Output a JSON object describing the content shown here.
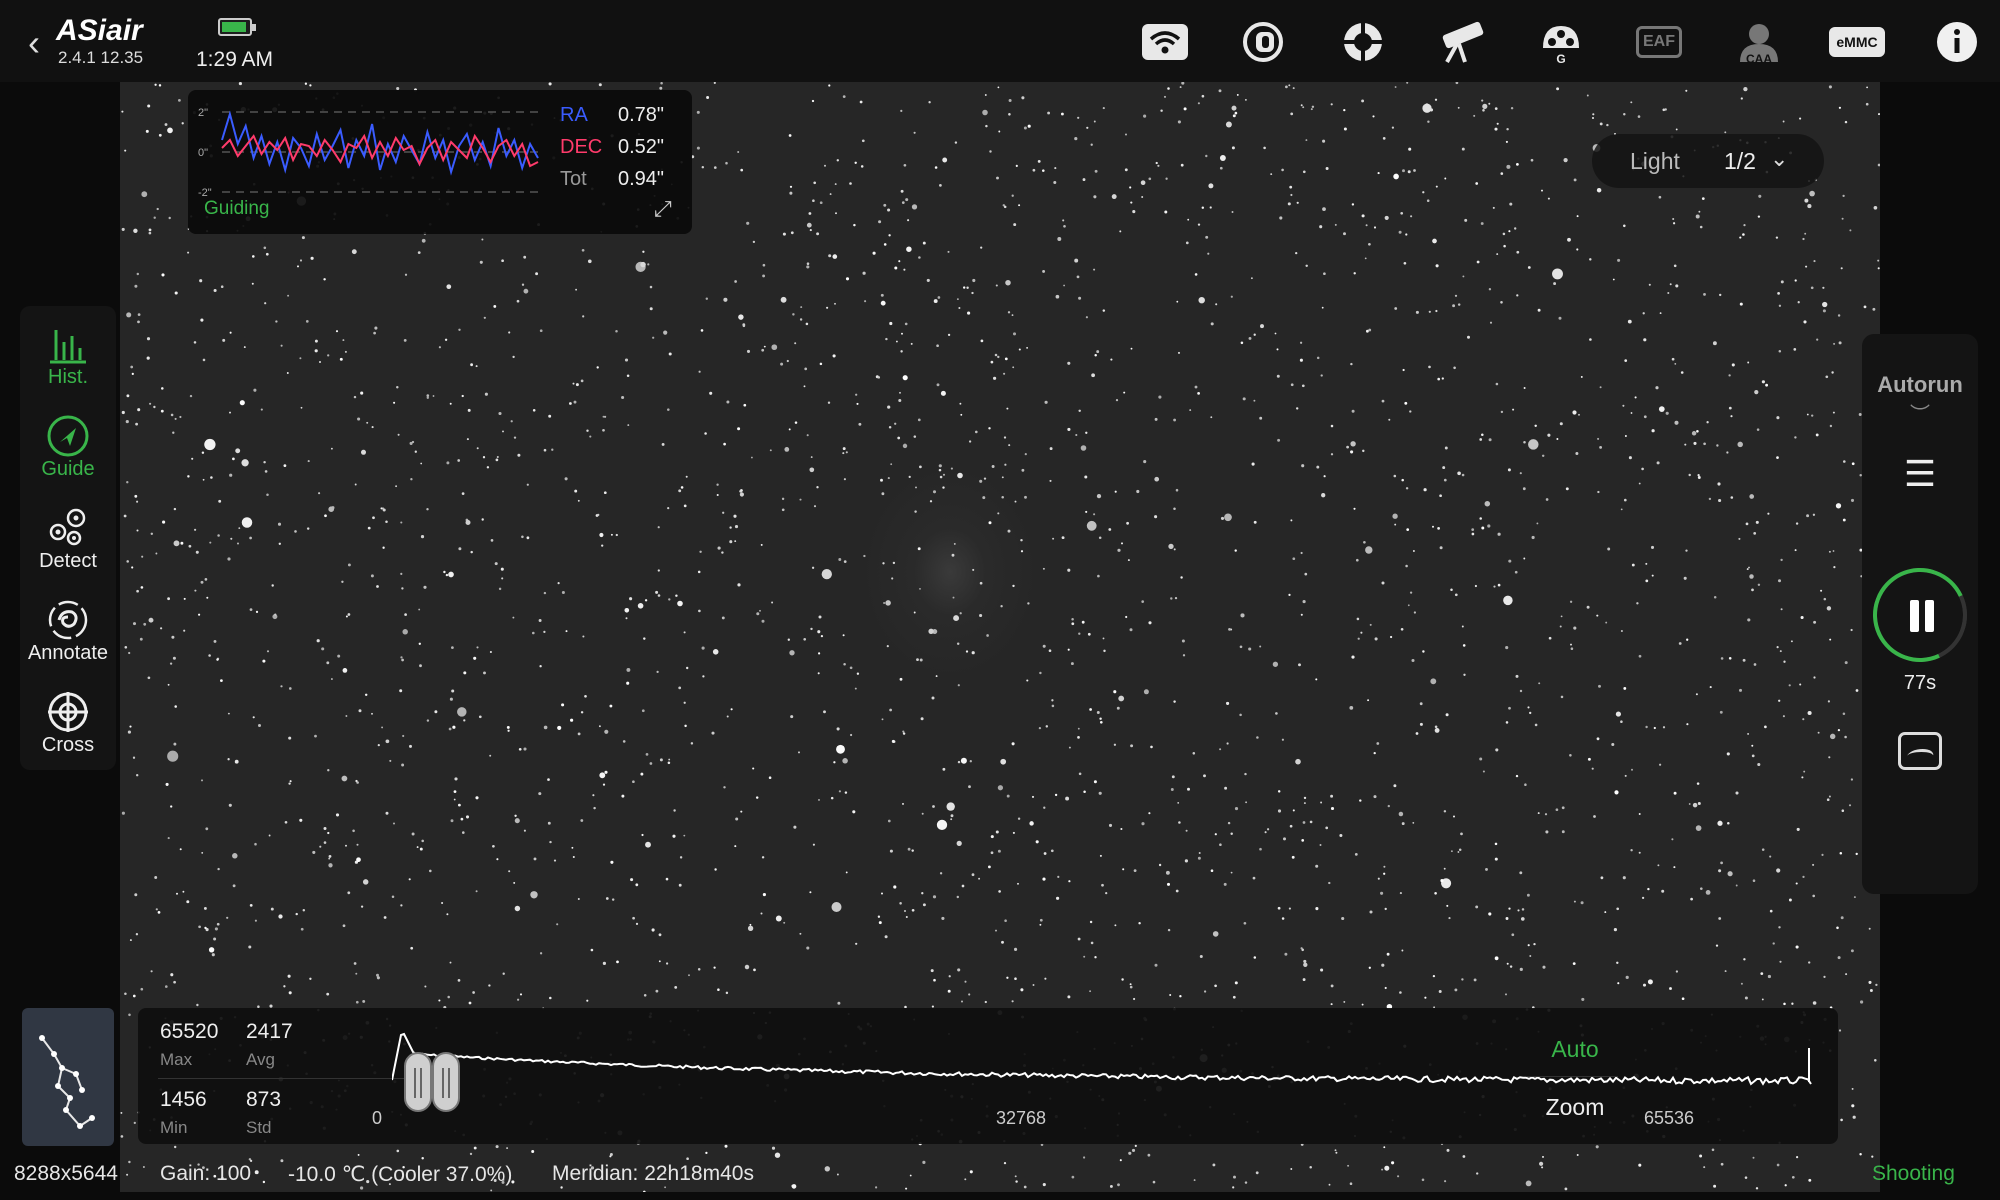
{
  "app": {
    "brand": "ASiair",
    "version": "2.4.1 12.35",
    "time": "1:29 AM",
    "back_icon": "chevron-left-icon"
  },
  "toolbar": {
    "icons": [
      "wifi-icon",
      "camera-icon",
      "focus-target-icon",
      "telescope-icon",
      "guide-camera-icon",
      "eaf-icon",
      "caa-icon",
      "emmc-icon",
      "info-icon"
    ],
    "guide_cam_label": "G",
    "eaf_label": "EAF",
    "caa_label": "CAA",
    "emmc_label": "eMMC"
  },
  "guide": {
    "axis_top": "2\"",
    "axis_mid": "0\"",
    "axis_bot": "-2\"",
    "ra_label": "RA",
    "ra_value": "0.78\"",
    "dec_label": "DEC",
    "dec_value": "0.52\"",
    "tot_label": "Tot",
    "tot_value": "0.94\"",
    "status": "Guiding",
    "colors": {
      "ra": "#3a5cff",
      "dec": "#ff3b6b",
      "status": "#39b54a"
    },
    "ra_trace": [
      0.6,
      1.9,
      0.4,
      1.3,
      -0.3,
      0.8,
      -0.6,
      0.5,
      -0.9,
      0.7,
      0.2,
      -0.7,
      0.9,
      -0.4,
      0.3,
      1.1,
      -0.8,
      0.6,
      -0.2,
      1.4,
      -0.9,
      0.4,
      -0.5,
      0.8,
      0.1,
      -0.6,
      1.0,
      -0.3,
      0.6,
      -1.0,
      0.3,
      0.9,
      -0.4,
      0.5,
      -0.7,
      1.2,
      -0.2,
      0.6,
      -0.8,
      0.4,
      -0.3
    ],
    "dec_trace": [
      0.2,
      0.6,
      -0.2,
      0.3,
      0.8,
      -0.1,
      0.5,
      0.1,
      0.7,
      -0.4,
      0.4,
      0.3,
      -0.2,
      0.6,
      0.1,
      -0.5,
      0.4,
      0.2,
      0.8,
      -0.3,
      0.5,
      -0.2,
      0.7,
      0.1,
      0.3,
      -0.6,
      0.2,
      0.6,
      -0.4,
      0.5,
      0.1,
      -0.3,
      0.8,
      0.2,
      -0.5,
      0.3,
      0.6,
      -0.2,
      0.4,
      -0.7,
      -0.5
    ]
  },
  "frame": {
    "type": "Light",
    "count": "1/2"
  },
  "tools": [
    {
      "label": "Hist.",
      "icon": "histogram-icon",
      "active": true
    },
    {
      "label": "Guide",
      "icon": "guide-icon",
      "active": true
    },
    {
      "label": "Detect",
      "icon": "detect-icon",
      "active": false
    },
    {
      "label": "Annotate",
      "icon": "annotate-icon",
      "active": false
    },
    {
      "label": "Cross",
      "icon": "crosshair-icon",
      "active": false
    }
  ],
  "autorun": {
    "title": "Autorun",
    "exposure": "77s",
    "progress": 0.9
  },
  "histogram": {
    "max": "65520",
    "max_label": "Max",
    "avg": "2417",
    "avg_label": "Avg",
    "min": "1456",
    "min_label": "Min",
    "std": "873",
    "std_label": "Std",
    "tick_start": "0",
    "tick_mid": "32768",
    "tick_end": "65536",
    "auto_label": "Auto",
    "zoom_label": "Zoom"
  },
  "status": {
    "resolution": "8288x5644",
    "gain": "Gain: 100",
    "temperature": "-10.0 ℃ (Cooler 37.0%)",
    "meridian": "Meridian: 22h18m40s",
    "state": "Shooting"
  }
}
